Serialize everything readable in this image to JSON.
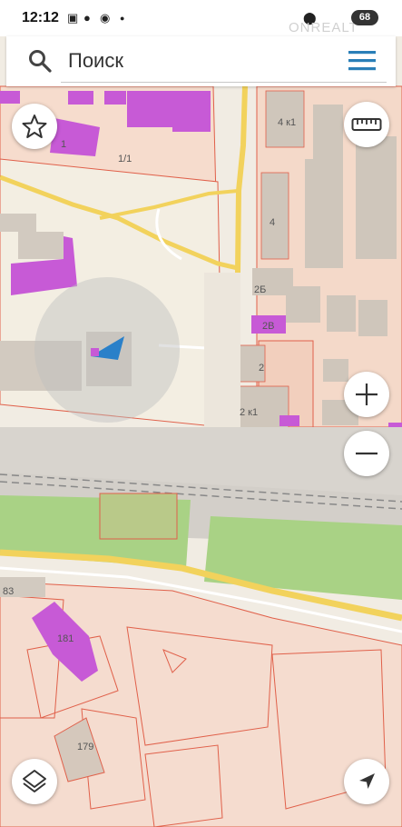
{
  "status_bar": {
    "time": "12:12",
    "battery": "68",
    "watermark": "ONREALT"
  },
  "search": {
    "placeholder": "Поиск"
  },
  "map": {
    "building_labels": {
      "b1": "1",
      "b1_1": "1/1",
      "b4k1": "4 к1",
      "b4": "4",
      "b2b": "2Б",
      "b2v": "2В",
      "b2": "2",
      "b2k1": "2 к1",
      "b83": "83",
      "b181": "181",
      "b179": "179"
    },
    "colors": {
      "land": "#f1ece3",
      "parcel_fill": "#f5d6c6",
      "parcel_border": "#e0604a",
      "building": "#cfc6bb",
      "highlight_building": "#c75ad6",
      "road_yellow": "#f2d25c",
      "railway_area": "#d6d3cd",
      "green": "#9fcf7a",
      "location_arrow": "#2a80c9"
    }
  },
  "controls": {
    "favorite_icon": "star-icon",
    "ruler_icon": "ruler-icon",
    "zoom_in_icon": "plus-icon",
    "zoom_out_icon": "minus-icon",
    "layers_icon": "layers-icon",
    "locate_icon": "navigation-arrow-icon"
  }
}
